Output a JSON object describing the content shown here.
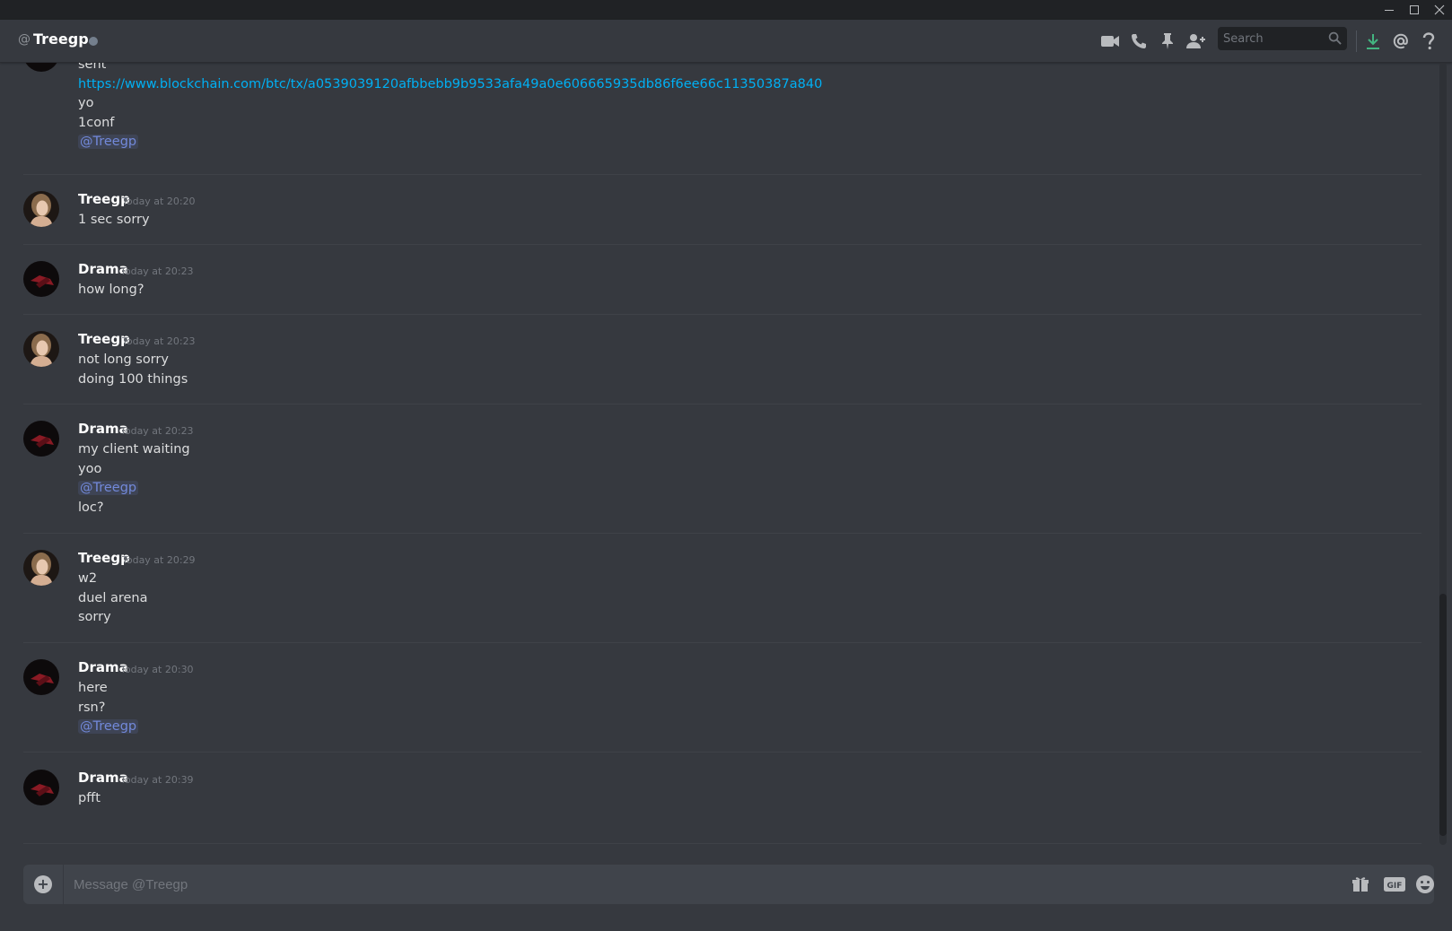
{
  "header": {
    "at_symbol": "@",
    "channel_name": "Treegp",
    "search_placeholder": "Search"
  },
  "icons": {
    "video": "video-call-icon",
    "call": "voice-call-icon",
    "pin": "pin-icon",
    "add_friend": "add-friend-icon",
    "search": "search-icon",
    "download": "download-icon",
    "mentions": "mentions-icon",
    "help": "help-icon",
    "gift": "gift-icon",
    "gif": "gif-icon",
    "emoji": "emoji-icon",
    "add": "add-attachment-icon"
  },
  "colors": {
    "background": "#36393f",
    "link": "#00b0f4",
    "mention": "#7289da",
    "download_accent": "#43b581"
  },
  "messages": [
    {
      "author": "",
      "timestamp": "",
      "lines": [
        {
          "text": "sent",
          "type": "text"
        },
        {
          "text": "https://www.blockchain.com/btc/tx/a0539039120afbbebb9b9533afa49a0e606665935db86f6ee66c11350387a840",
          "type": "link"
        },
        {
          "text": "yo",
          "type": "text"
        },
        {
          "text": "1conf",
          "type": "text"
        },
        {
          "text": "@Treegp",
          "type": "mention"
        }
      ]
    },
    {
      "author": "Treegp",
      "timestamp": "Today at 20:20",
      "lines": [
        {
          "text": "1 sec sorry",
          "type": "text"
        }
      ]
    },
    {
      "author": "Drama",
      "timestamp": "Today at 20:23",
      "lines": [
        {
          "text": "how long?",
          "type": "text"
        }
      ]
    },
    {
      "author": "Treegp",
      "timestamp": "Today at 20:23",
      "lines": [
        {
          "text": "not long sorry",
          "type": "text"
        },
        {
          "text": "doing 100 things",
          "type": "text"
        }
      ]
    },
    {
      "author": "Drama",
      "timestamp": "Today at 20:23",
      "lines": [
        {
          "text": "my client waiting",
          "type": "text"
        },
        {
          "text": "yoo",
          "type": "text"
        },
        {
          "text": "@Treegp",
          "type": "mention"
        },
        {
          "text": "loc?",
          "type": "text"
        }
      ]
    },
    {
      "author": "Treegp",
      "timestamp": "Today at 20:29",
      "lines": [
        {
          "text": "w2",
          "type": "text"
        },
        {
          "text": "duel arena",
          "type": "text"
        },
        {
          "text": "sorry",
          "type": "text"
        }
      ]
    },
    {
      "author": "Drama",
      "timestamp": "Today at 20:30",
      "lines": [
        {
          "text": "here",
          "type": "text"
        },
        {
          "text": "rsn?",
          "type": "text"
        },
        {
          "text": "@Treegp",
          "type": "mention"
        }
      ]
    },
    {
      "author": "Drama",
      "timestamp": "Today at 20:39",
      "lines": [
        {
          "text": "pfft",
          "type": "text"
        }
      ]
    }
  ],
  "composer": {
    "placeholder": "Message @Treegp"
  }
}
